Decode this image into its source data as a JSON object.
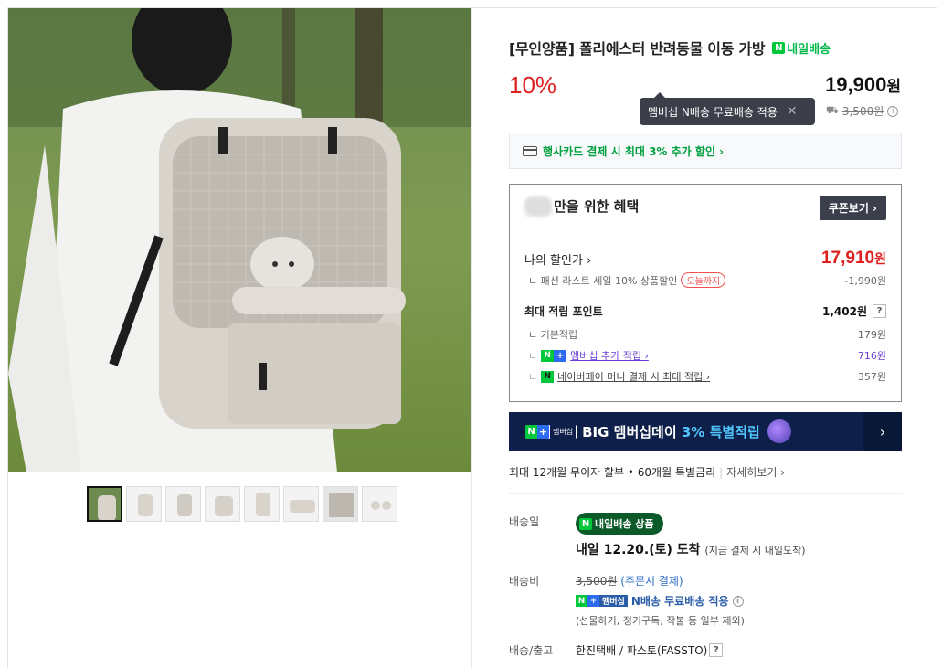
{
  "product": {
    "title": "[무인양품] 폴리에스터 반려동물 이동 가방",
    "tomorrow_delivery": "내일배송",
    "discount": "10%",
    "price": "19,900",
    "price_unit": "원",
    "original_price": "3,500원",
    "tooltip": "멤버십 N배송 무료배송 적용"
  },
  "card_promo": "행사카드 결제 시 최대 3% 추가 할인 ›",
  "benefit": {
    "title": "만을 위한 혜택",
    "coupon_button": "쿠폰보기 ›",
    "my_price_label": "나의 할인가 ›",
    "my_price_value": "17,910",
    "my_price_unit": "원",
    "sale_label": "ㄴ 패션 라스트 세일 10% 상품할인",
    "sale_pill": "오늘까지",
    "sale_value": "-1,990원",
    "points_label": "최대 적립 포인트",
    "points_value": "1,402원",
    "base_label": "ㄴ 기본적립",
    "base_value": "179원",
    "member_label": "멤버십 추가 적립 ›",
    "member_value": "716원",
    "npay_label": "네이버페이 머니 결제 시 최대 적립 ›",
    "npay_value": "357원"
  },
  "banner": {
    "badge_text": "멤버십",
    "text_prefix": "BIG 멤버십데이 ",
    "text_highlight": "3% 특별적립",
    "arrow": "›"
  },
  "installment": {
    "text": "최대 12개월 무이자 할부 • 60개월 특별금리",
    "more": "자세히보기 ›"
  },
  "shipping": {
    "date_label": "배송일",
    "pill": "내일배송 상품",
    "arrival": "내일 12.20.(토) 도착",
    "arrival_note": "(지금 결제 시 내일도착)",
    "fee_label": "배송비",
    "fee_original": "3,500원",
    "fee_note": "(주문시 결제)",
    "member_badge": "멤버십",
    "member_free": "N배송 무료배송 적용",
    "exclusions": "(선물하기, 정기구독, 작불 등 일부 제외)",
    "courier_label": "배송/출고",
    "courier": "한진택배 / 파스토(FASSTO)"
  },
  "icons": {
    "info": "info-circle-icon",
    "close": "close-icon",
    "card": "credit-card-icon",
    "help": "question-icon"
  },
  "colors": {
    "discount_red": "#e02020",
    "naver_green": "#00c73c",
    "banner_navy": "#0e1f4a",
    "member_purple": "#6a3fd6"
  }
}
